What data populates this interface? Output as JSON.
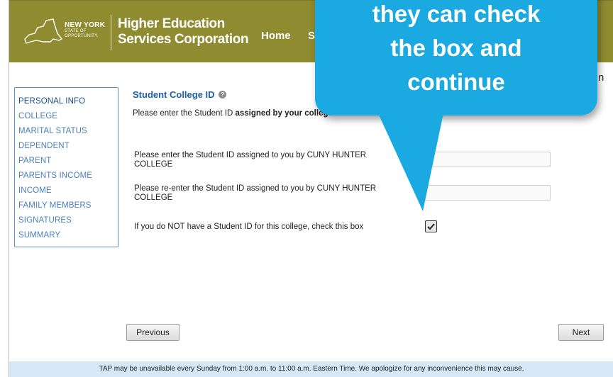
{
  "header": {
    "logo": {
      "line1": "NEW YORK",
      "line2": "STATE OF",
      "line3": "OPPORTUNITY."
    },
    "org_line1": "Higher Education",
    "org_line2": "Services Corporation",
    "nav": [
      {
        "label": "Home"
      },
      {
        "label": "S"
      }
    ]
  },
  "right_edge_text": "n",
  "sidebar": {
    "items": [
      {
        "label": "PERSONAL INFO",
        "active": true
      },
      {
        "label": "COLLEGE"
      },
      {
        "label": "MARITAL STATUS"
      },
      {
        "label": "DEPENDENT"
      },
      {
        "label": "PARENT"
      },
      {
        "label": "PARENTS INCOME"
      },
      {
        "label": "INCOME"
      },
      {
        "label": "FAMILY MEMBERS"
      },
      {
        "label": "SIGNATURES"
      },
      {
        "label": "SUMMARY"
      }
    ]
  },
  "main": {
    "title": "Student College ID",
    "help_icon": "help-icon",
    "intro_prefix": "Please enter the Student ID ",
    "intro_bold": "assigned by your college",
    "question1": "Please enter the Student ID assigned to you by CUNY HUNTER COLLEGE",
    "question2": "Please re-enter the Student ID assigned to you by CUNY HUNTER COLLEGE",
    "question3": "If you do NOT have a Student ID for this college, check this box",
    "field1_value": "",
    "field2_value": "",
    "no_id_checked": true,
    "previous_label": "Previous",
    "next_label": "Next"
  },
  "footer": {
    "text": "TAP may be unavailable every Sunday from 1:00 a.m. to 11:00 a.m. Eastern Time. We apologize for any inconvenience this may cause."
  },
  "callout": {
    "lines": [
      "they can check",
      "the box and",
      "continue"
    ]
  },
  "colors": {
    "header_bg": "#8e8b30",
    "link": "#4a7fbf",
    "title": "#1f5ea8",
    "callout": "#1aa9e1",
    "footer_bg": "#d6e8f5"
  }
}
